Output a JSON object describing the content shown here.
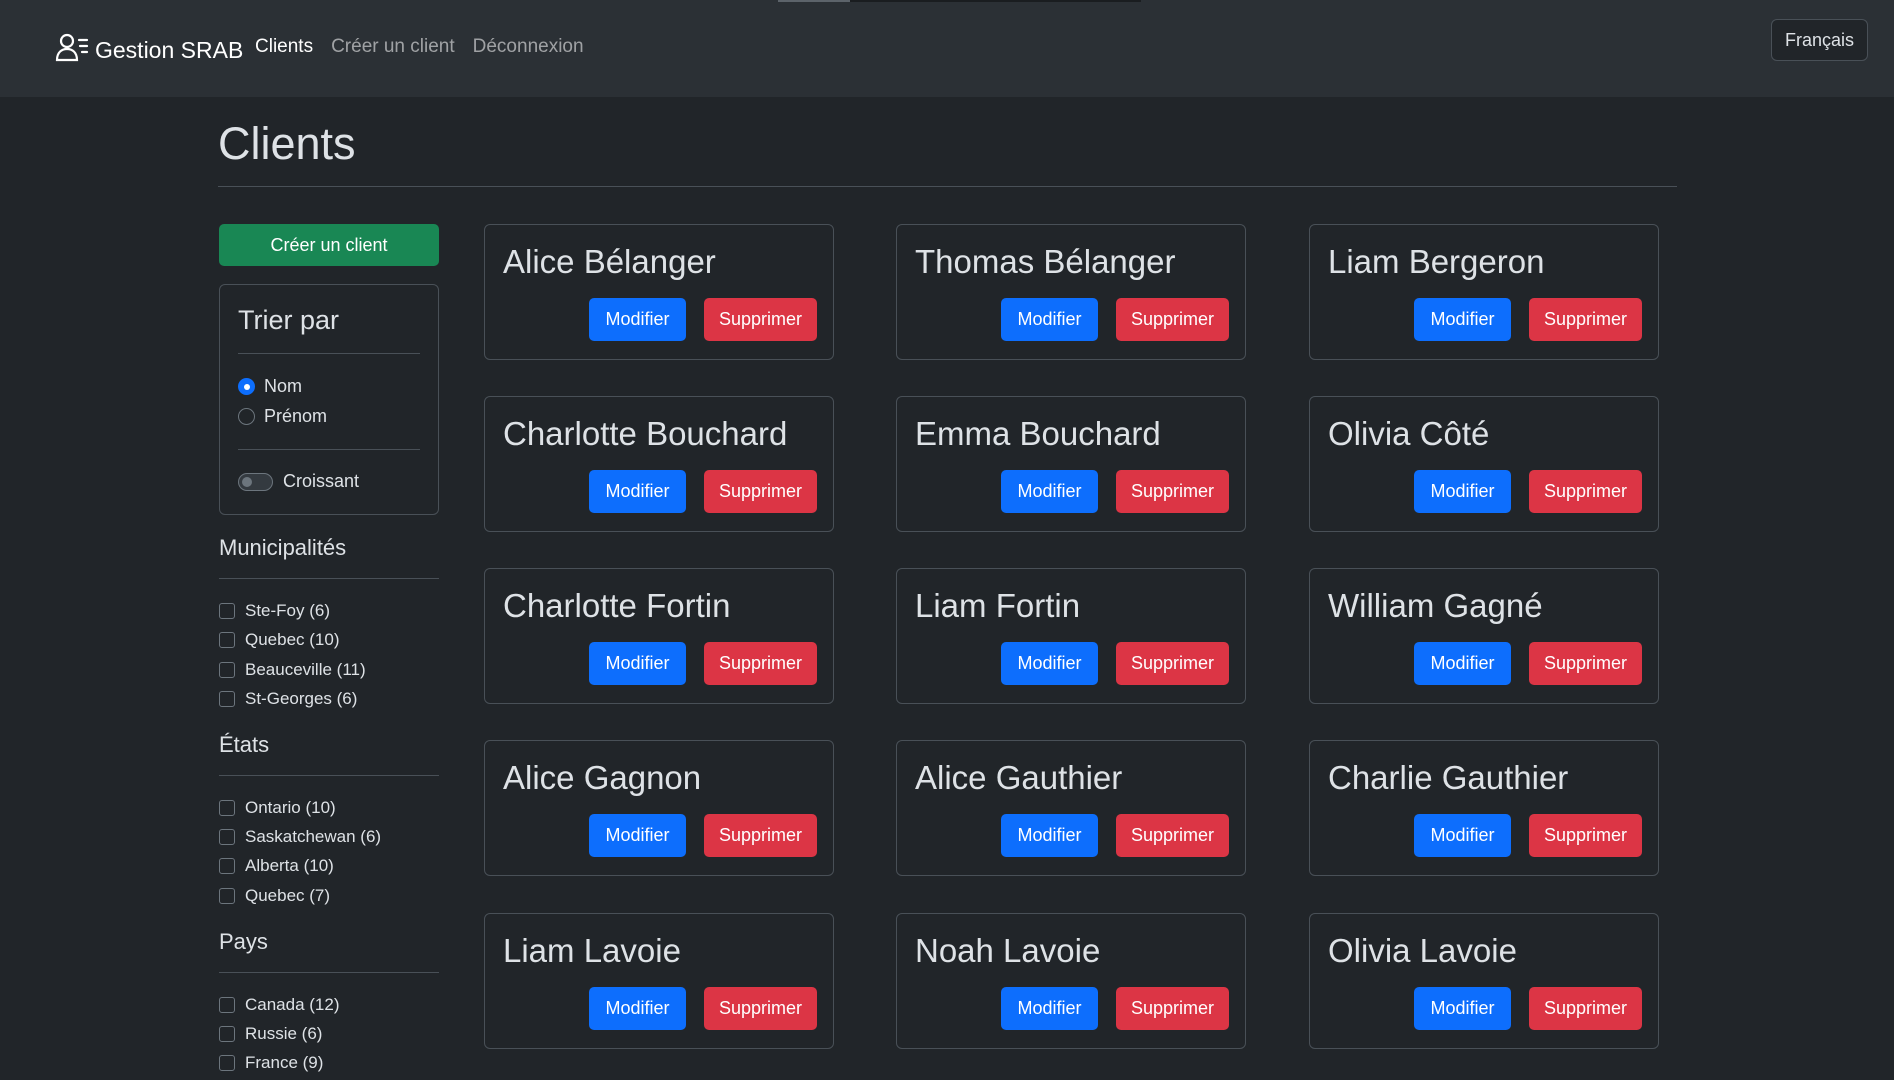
{
  "navbar": {
    "brand": "Gestion SRAB",
    "links": [
      "Clients",
      "Créer un client",
      "Déconnexion"
    ],
    "language": "Français"
  },
  "main": {
    "title": "Clients"
  },
  "sidebar": {
    "create_label": "Créer un client",
    "sort": {
      "title": "Trier par",
      "options": [
        "Nom",
        "Prénom"
      ],
      "selected": "Nom",
      "toggle_label": "Croissant",
      "toggle_on": false
    },
    "filters": [
      {
        "title": "Municipalités",
        "items": [
          "Ste-Foy (6)",
          "Quebec (10)",
          "Beauceville (11)",
          "St-Georges (6)"
        ]
      },
      {
        "title": "États",
        "items": [
          "Ontario (10)",
          "Saskatchewan (6)",
          "Alberta (10)",
          "Quebec (7)"
        ]
      },
      {
        "title": "Pays",
        "items": [
          "Canada (12)",
          "Russie (6)",
          "France (9)"
        ]
      }
    ]
  },
  "card_actions": {
    "edit_label": "Modifier",
    "delete_label": "Supprimer"
  },
  "clients": [
    "Alice Bélanger",
    "Thomas Bélanger",
    "Liam Bergeron",
    "Charlotte Bouchard",
    "Emma Bouchard",
    "Olivia Côté",
    "Charlotte Fortin",
    "Liam Fortin",
    "William Gagné",
    "Alice Gagnon",
    "Alice Gauthier",
    "Charlie Gauthier",
    "Liam Lavoie",
    "Noah Lavoie",
    "Olivia Lavoie"
  ],
  "colors": {
    "background": "#212529",
    "navbar": "#2b3035",
    "primary": "#0d6efd",
    "danger": "#dc3545",
    "success": "#198754"
  }
}
